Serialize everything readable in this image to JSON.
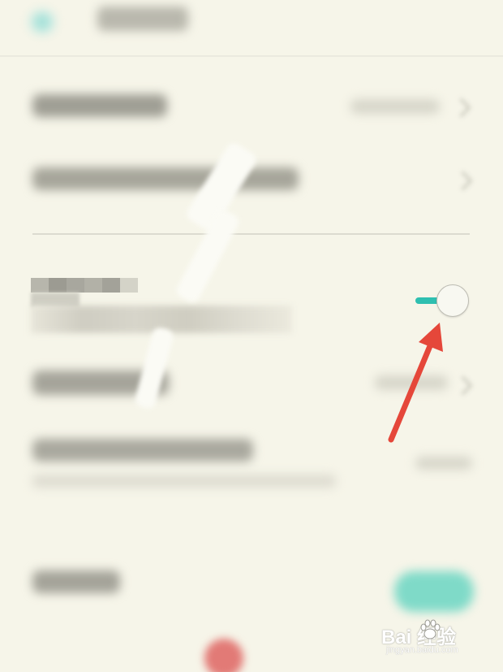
{
  "toggle": {
    "state": "on",
    "accent_color": "#2ebfb0"
  },
  "annotation": {
    "arrow_color": "#e5473a"
  },
  "watermark": {
    "brand": "Bai  经验",
    "url": "jingyan.baidu.com"
  },
  "colors": {
    "background": "#f6f5e9",
    "button_accent": "#7fdac8"
  }
}
